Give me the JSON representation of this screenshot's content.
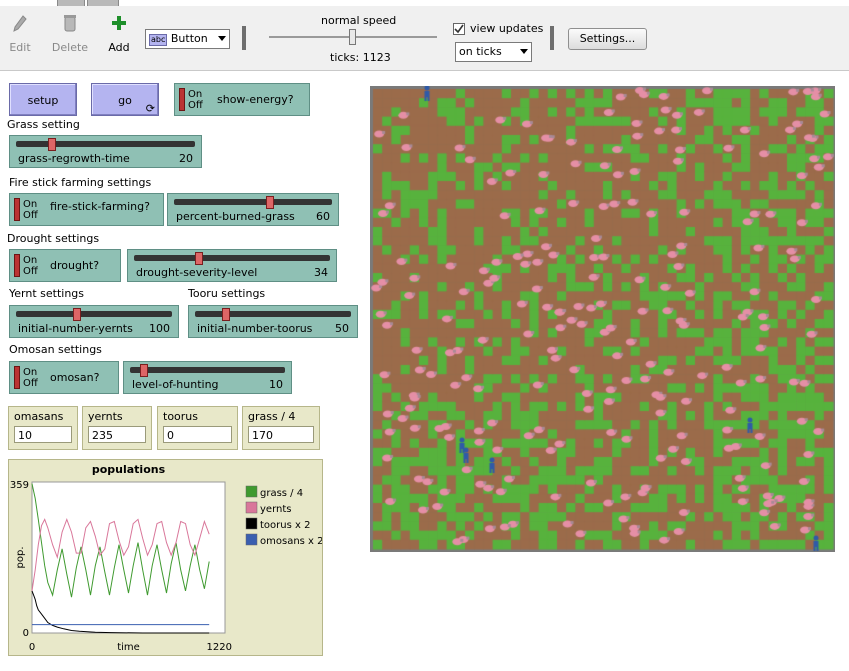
{
  "toolbar": {
    "edit_label": "Edit",
    "delete_label": "Delete",
    "add_label": "Add",
    "widget_type": "Button",
    "widget_type_icon_text": "abc",
    "speed_label": "normal speed",
    "ticks_label": "ticks: 1123",
    "view_updates_label": "view updates",
    "view_updates_checked": true,
    "update_mode": "on ticks",
    "settings_label": "Settings..."
  },
  "buttons": {
    "setup": "setup",
    "go": "go"
  },
  "switches": {
    "on": "On",
    "off": "Off",
    "show_energy": "show-energy?",
    "fire_stick": "fire-stick-farming?",
    "drought": "drought?",
    "omosan": "omosan?"
  },
  "sections": {
    "grass": "Grass setting",
    "fire": "Fire stick farming settings",
    "drought": "Drought settings",
    "yernt": "Yernt settings",
    "tooru": "Tooru settings",
    "omosan": "Omosan settings"
  },
  "sliders": {
    "grass_regrowth": {
      "name": "grass-regrowth-time",
      "value": "20",
      "fraction": 0.2
    },
    "percent_burned": {
      "name": "percent-burned-grass",
      "value": "60",
      "fraction": 0.6
    },
    "drought_severity": {
      "name": "drought-severity-level",
      "value": "34",
      "fraction": 0.34
    },
    "yernts": {
      "name": "initial-number-yernts",
      "value": "100",
      "fraction": 0.4
    },
    "toorus": {
      "name": "initial-number-toorus",
      "value": "50",
      "fraction": 0.2
    },
    "hunting": {
      "name": "level-of-hunting",
      "value": "10",
      "fraction": 0.1
    }
  },
  "monitors": [
    {
      "label": "omasans",
      "value": "10"
    },
    {
      "label": "yernts",
      "value": "235"
    },
    {
      "label": "toorus",
      "value": "0"
    },
    {
      "label": "grass / 4",
      "value": "170"
    }
  ],
  "colors": {
    "grass_patch": "#57b23d",
    "dirt_patch": "#9b6b4a",
    "yernt": "#e58fa6",
    "omosan": "#2f5aa8",
    "series_grass": "#3f9a2f",
    "series_yernts": "#d9779a",
    "series_toorus": "#000000",
    "series_omosans": "#3a5fb0"
  },
  "chart_data": {
    "type": "line",
    "title": "populations",
    "xlabel": "time",
    "ylabel": "pop.",
    "xlim": [
      0,
      1220
    ],
    "ylim": [
      0,
      359
    ],
    "x_tick_labels": [
      "0",
      "1220"
    ],
    "y_tick_labels": [
      "0",
      "359"
    ],
    "legend_position": "right",
    "series": [
      {
        "name": "grass / 4",
        "color": "#3f9a2f",
        "x": [
          0,
          20,
          40,
          60,
          80,
          100,
          130,
          160,
          190,
          220,
          250,
          280,
          310,
          340,
          370,
          400,
          430,
          460,
          490,
          520,
          550,
          580,
          610,
          640,
          670,
          700,
          730,
          760,
          790,
          820,
          850,
          880,
          910,
          940,
          970,
          1000,
          1030,
          1060,
          1090,
          1120
        ],
        "y": [
          355,
          320,
          270,
          215,
          160,
          120,
          90,
          150,
          200,
          140,
          85,
          155,
          205,
          150,
          90,
          160,
          205,
          145,
          90,
          155,
          210,
          150,
          95,
          160,
          215,
          150,
          90,
          160,
          210,
          150,
          95,
          165,
          215,
          150,
          100,
          160,
          210,
          150,
          105,
          170
        ]
      },
      {
        "name": "yernts",
        "color": "#d9779a",
        "x": [
          0,
          20,
          40,
          60,
          80,
          100,
          130,
          160,
          190,
          220,
          250,
          280,
          310,
          340,
          370,
          400,
          430,
          460,
          490,
          520,
          550,
          580,
          610,
          640,
          670,
          700,
          730,
          760,
          790,
          820,
          850,
          880,
          910,
          940,
          970,
          1000,
          1030,
          1060,
          1090,
          1120
        ],
        "y": [
          100,
          150,
          210,
          255,
          270,
          250,
          210,
          180,
          240,
          270,
          240,
          190,
          190,
          250,
          265,
          230,
          185,
          200,
          260,
          265,
          220,
          185,
          205,
          260,
          270,
          225,
          185,
          210,
          260,
          265,
          215,
          185,
          215,
          265,
          260,
          210,
          185,
          225,
          265,
          235
        ]
      },
      {
        "name": "toorus x 2",
        "color": "#000000",
        "x": [
          0,
          10,
          20,
          30,
          40,
          60,
          80,
          100,
          130,
          160,
          200,
          250,
          300,
          400,
          500,
          700,
          900,
          1120
        ],
        "y": [
          100,
          90,
          80,
          65,
          55,
          45,
          35,
          25,
          18,
          14,
          10,
          6,
          4,
          2,
          1,
          0,
          0,
          0
        ]
      },
      {
        "name": "omosans x 2",
        "color": "#3a5fb0",
        "x": [
          0,
          1120
        ],
        "y": [
          20,
          20
        ]
      }
    ]
  }
}
